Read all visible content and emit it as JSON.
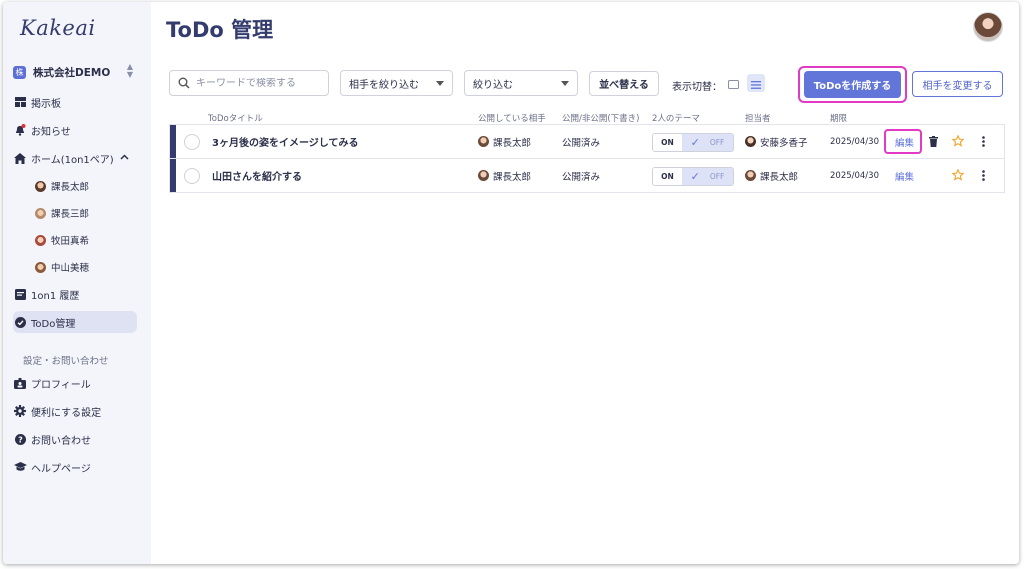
{
  "app": {
    "logo": "Kakeai"
  },
  "company": {
    "badge": "株",
    "name": "株式会社DEMO"
  },
  "sidebar": {
    "items": [
      {
        "label": "掲示板"
      },
      {
        "label": "お知らせ"
      },
      {
        "label": "ホーム(1on1ペア)"
      },
      {
        "label": "課長太郎"
      },
      {
        "label": "課長三郎"
      },
      {
        "label": "牧田真希"
      },
      {
        "label": "中山美穂"
      },
      {
        "label": "1on1 履歴"
      },
      {
        "label": "ToDo管理"
      }
    ],
    "settings_label": "設定・お問い合わせ",
    "settings_items": [
      {
        "label": "プロフィール"
      },
      {
        "label": "便利にする設定"
      },
      {
        "label": "お問い合わせ"
      },
      {
        "label": "ヘルプページ"
      }
    ]
  },
  "page": {
    "title": "ToDo 管理"
  },
  "toolbar": {
    "search_placeholder": "キーワードで検索する",
    "partner_filter": "相手を絞り込む",
    "filter": "絞り込む",
    "sort": "並べ替える",
    "view_label": "表示切替：",
    "create": "ToDoを作成する",
    "change_partner": "相手を変更する"
  },
  "table": {
    "headers": {
      "title": "ToDoタイトル",
      "partner": "公開している相手",
      "visibility": "公開/非公開(下書き)",
      "theme": "2人のテーマ",
      "assignee": "担当者",
      "due": "期限"
    },
    "rows": [
      {
        "title": "3ヶ月後の姿をイメージしてみる",
        "partner": "課長太郎",
        "visibility": "公開済み",
        "toggle_on": "ON",
        "toggle_off": "OFF",
        "assignee": "安藤多香子",
        "due": "2025/04/30",
        "edit": "編集"
      },
      {
        "title": "山田さんを紹介する",
        "partner": "課長太郎",
        "visibility": "公開済み",
        "toggle_on": "ON",
        "toggle_off": "OFF",
        "assignee": "課長太郎",
        "due": "2025/04/30",
        "edit": "編集"
      }
    ]
  },
  "colors": {
    "accent": "#6275d8",
    "navy": "#343c6e",
    "highlight": "#e23ac4"
  }
}
